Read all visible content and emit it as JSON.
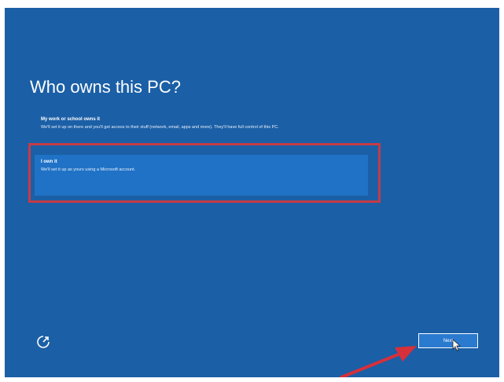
{
  "page": {
    "title": "Who owns this PC?"
  },
  "options": [
    {
      "title": "My work or school owns it",
      "description": "We'll set it up on there and you'll get access to their stuff (network, email, apps and more). They'll have full control of this PC."
    },
    {
      "title": "I own it",
      "description": "We'll set it up as yours using a Microsoft account.",
      "selected": true
    }
  ],
  "footer": {
    "ease_of_access_icon": "ease-of-access-icon",
    "next_label": "Next"
  },
  "colors": {
    "background": "#1b5fa6",
    "selected_option": "#1f72c6",
    "annotation": "#c43b47"
  }
}
